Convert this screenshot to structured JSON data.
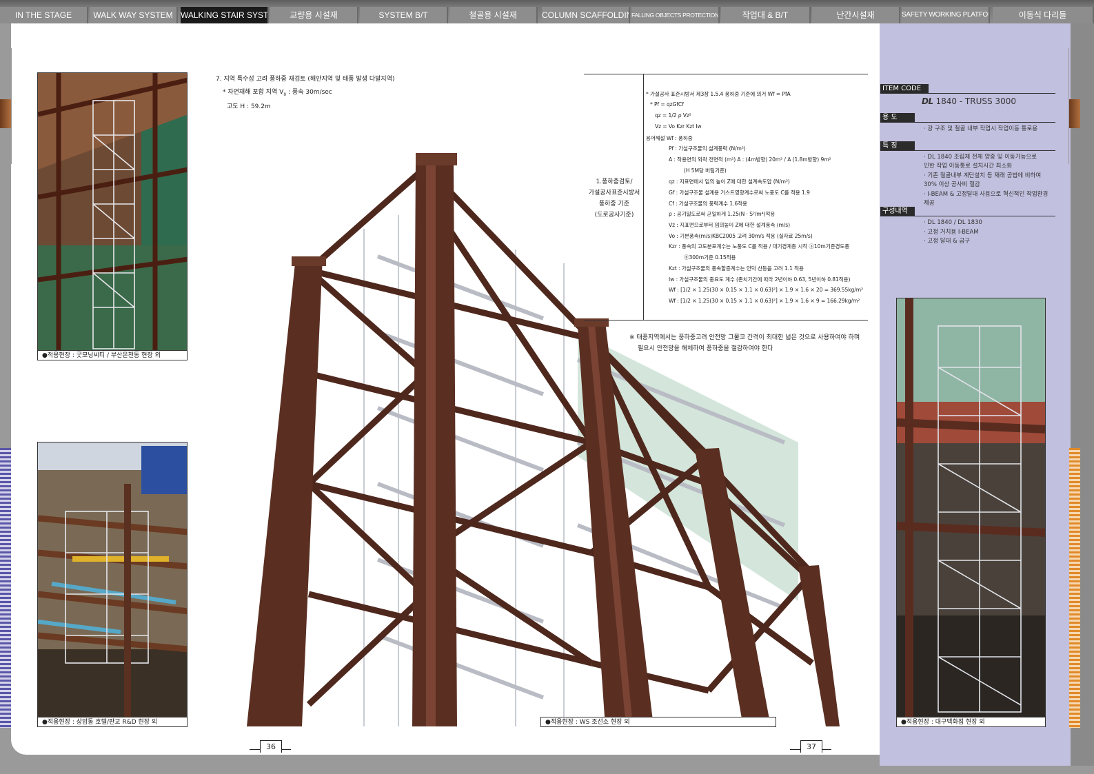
{
  "tabs": [
    {
      "label": "IN THE STAGE",
      "active": false
    },
    {
      "label": "WALK WAY SYSTEM",
      "active": false
    },
    {
      "label": "WALKING STAIR SYSTEM",
      "active": true
    },
    {
      "label": "교량용 시설재",
      "active": false
    },
    {
      "label": "SYSTEM B/T",
      "active": false
    },
    {
      "label": "철골용 시설재",
      "active": false
    },
    {
      "label": "COLUMN SCAFFOLDING",
      "active": false
    },
    {
      "label": "FALLING OBJECTS PROTECTION PLATFORM",
      "active": false
    },
    {
      "label": "작업대 & B/T",
      "active": false
    },
    {
      "label": "난간시설재",
      "active": false
    },
    {
      "label": "SAFETY WORKING PLATFORM",
      "active": false
    },
    {
      "label": "이동식 다리들",
      "active": false
    }
  ],
  "captions": {
    "top_left": "●적용현장 : 굿모닝씨티 / 부산온천동 현장 외",
    "bottom_left": "●적용현장 : 상암동 호텔/판교 R&D 현장 외",
    "center": "●적용현장 : WS 조선소 현장 외",
    "right": "●적용현장 : 대구백화점 현장 외"
  },
  "heading": {
    "line1": "7. 지역 특수성 고려 풍하중 재검토 (해안지역 및 태풍 발생 다발지역)",
    "line2_prefix": "* 자연재해 포함 지역 V",
    "line2_sub": "0",
    "line2_suffix": " : 풍속 30m/sec",
    "line3": "고도     H : 59.2m"
  },
  "center_label": [
    "1.풍하중검토/",
    "가설공사표준시방서",
    "풍하중 기준",
    "(도로공사기준)"
  ],
  "spec_lines": [
    "* 가설공사 표준시방서 제3장 1.5.4 풍하중 기준에 의거 Wf = PfA",
    "* Pf = qzGfCf",
    "qz = 1/2 ρ Vz²",
    "Vz = Vo Kzr Kzt Iw",
    "용어해설  Wf : 풍하중",
    "Pf  : 가설구조물의 설계풍력 (N/m²)",
    "A   : 작용면의 외곽 전면적 (m²)   A : (4m방향) 20m²  / A (1.8m방향) 9m²",
    "(H 5M당 버팀기준)",
    "qz  : 지표면에서 임의 높이 Z에 대한 설계속도압 (N/m²)",
    "Gf  : 가설구조물 설계용 거스트영향계수로써 노풍도 C를 적용 1.9",
    "Cf  : 가설구조물의 풍력계수 1.6적용",
    "ρ   : 공기밀도로써 균일하게 1.25(N · S²/m⁴)적용",
    "Vz  : 지표면으로부터 임의높이 Z에 대한 설계풍속 (m/s)",
    "Vo  : 기본풍속(m/s)KBC2005 고려 30m/s 적용 (실자료 25m/s)",
    "Kzr : 풍속의 고도분포계수는 노풍도 C를 적용 / 대기경계층 시작 ⓐ10m기준경도풍",
    "ⓑ300m기준 0.15적용",
    "Kzt : 가설구조물의 풍속할증계수는 언덕 산등을 고려 1.1 적용",
    "Iw  : 가설구조물의 중요도 계수 (존치기간에 따라 2년이하 0.63, 5년이하 0.81적용)",
    "Wf  : [1/2 × 1.25(30 × 0.15 × 1.1 × 0.63)²] × 1.9 × 1.6 × 20 = 369.55kg/m²",
    "Wf  : [1/2 × 1.25(30 × 0.15 × 1.1 × 0.63)²] × 1.9 × 1.6 × 9 = 166.29kg/m²"
  ],
  "note": {
    "line1": "※ 태풍지역에서는 풍하중고려 안전망 그물코 간격이 최대한 넓은 것으로 사용하여야 하며",
    "line2": "필요시 안전망을 해체하여 풍하중을 절감하여야 한다"
  },
  "page_numbers": {
    "left": "36",
    "right": "37"
  },
  "right_panel": {
    "item_code_label": "ITEM CODE",
    "item_code_mark": "DL",
    "item_code_value": "1840 - TRUSS 3000",
    "usage_label": "용   도",
    "usage_text": "· 강 구조 및 철골 내부 작업시 작업이동 통로용",
    "feature_label": "특   징",
    "features": [
      "· DL 1840 조립체 전체 양중 및 이동가능으로",
      "  인한 작업 이동통로 설치시간 최소화",
      "· 기존 철골내부 계단설치 등 재래 공법에 비하여",
      "  30% 이상 공사비 절감",
      "· I-BEAM & 고정달대 사용으로 혁신적인 작업환경",
      "  제공"
    ],
    "composition_label": "구성내역",
    "composition": [
      "· DL 1840 / DL 1830",
      "· 고정 거치용 I-BEAM",
      "· 고정 달대 & 금구"
    ]
  },
  "colors": {
    "lavender": "#c2c0df",
    "steel": "#5a2f22",
    "tab_bg": "#8d8d8d",
    "tab_active": "#1a1a1a"
  }
}
